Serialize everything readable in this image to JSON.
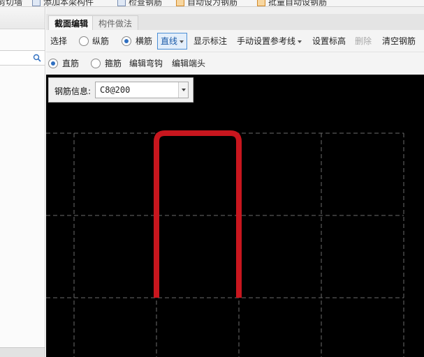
{
  "top_toolbar": {
    "items": [
      "剪切墙",
      "添加本梁构件",
      "检查钢筋",
      "自动设为钢筋",
      "批量自动设钢筋"
    ]
  },
  "tabs": [
    {
      "label": "截面编辑",
      "active": true
    },
    {
      "label": "构件做法",
      "active": false
    }
  ],
  "toolbar_row1": {
    "select": "选择",
    "longitudinal": "纵筋",
    "transverse": "横筋",
    "transverse_selected": true,
    "line_dropdown": "直线",
    "show_label": "显示标注",
    "manual_ref": "手动设置参考线",
    "set_elevation": "设置标高",
    "delete": "删除",
    "clear_rebar": "清空钢筋"
  },
  "toolbar_row2": {
    "straight": "直筋",
    "straight_selected": true,
    "stirrup": "箍筋",
    "edit_hook": "编辑弯钩",
    "edit_end": "编辑端头"
  },
  "rebar_info": {
    "label": "钢筋信息:",
    "value": "C8@200"
  },
  "colors": {
    "canvas_bg": "#000000",
    "grid": "#6b6b6b",
    "rebar": "#c8161e",
    "accent": "#2f6fc0"
  }
}
